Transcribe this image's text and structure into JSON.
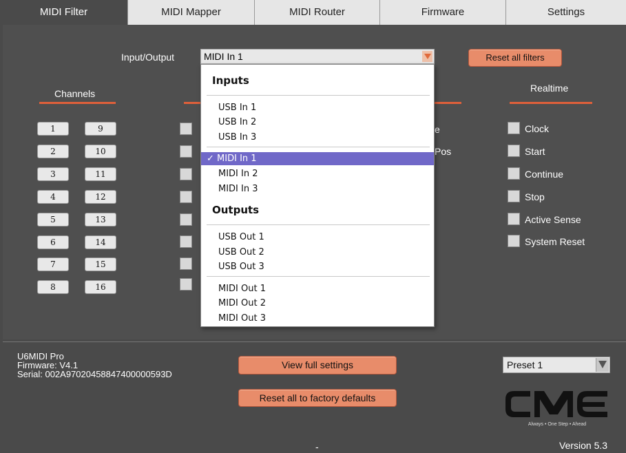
{
  "tabs": [
    "MIDI Filter",
    "MIDI Mapper",
    "MIDI Router",
    "Firmware",
    "Settings"
  ],
  "active_tab": "MIDI Filter",
  "io": {
    "label": "Input/Output",
    "value": "MIDI In 1"
  },
  "reset_filters_label": "Reset all filters",
  "channels": {
    "heading": "Channels",
    "col1": [
      "1",
      "2",
      "3",
      "4",
      "5",
      "6",
      "7",
      "8"
    ],
    "col2": [
      "9",
      "10",
      "11",
      "12",
      "13",
      "14",
      "15",
      "16"
    ]
  },
  "partial_labels": {
    "mid1": "e",
    "mid2": "Pos"
  },
  "realtime": {
    "heading": "Realtime",
    "items": [
      "Clock",
      "Start",
      "Continue",
      "Stop",
      "Active Sense",
      "System Reset"
    ]
  },
  "dropdown": {
    "inputs_heading": "Inputs",
    "usb_in": [
      "USB In 1",
      "USB In 2",
      "USB In 3"
    ],
    "midi_in": [
      "MIDI In 1",
      "MIDI In 2",
      "MIDI In 3"
    ],
    "outputs_heading": "Outputs",
    "usb_out": [
      "USB Out 1",
      "USB Out 2",
      "USB Out 3"
    ],
    "midi_out": [
      "MIDI Out 1",
      "MIDI Out 2",
      "MIDI Out 3"
    ],
    "selected": "MIDI In 1",
    "check": "✓"
  },
  "device": {
    "name": "U6MIDI Pro",
    "firmware": "Firmware: V4.1",
    "serial": "Serial: 002A97020458847400000593D"
  },
  "view_settings_label": "View full settings",
  "factory_reset_label": "Reset all to factory defaults",
  "preset": "Preset 1",
  "logo": {
    "text": "CME",
    "tagline": "Always • One Step • Ahead"
  },
  "status_dash": "-",
  "version": "Version 5.3",
  "colors": {
    "accent": "#e0603a",
    "button": "#e88c6a",
    "selected": "#7068c8",
    "bg": "#4a4a4a"
  }
}
